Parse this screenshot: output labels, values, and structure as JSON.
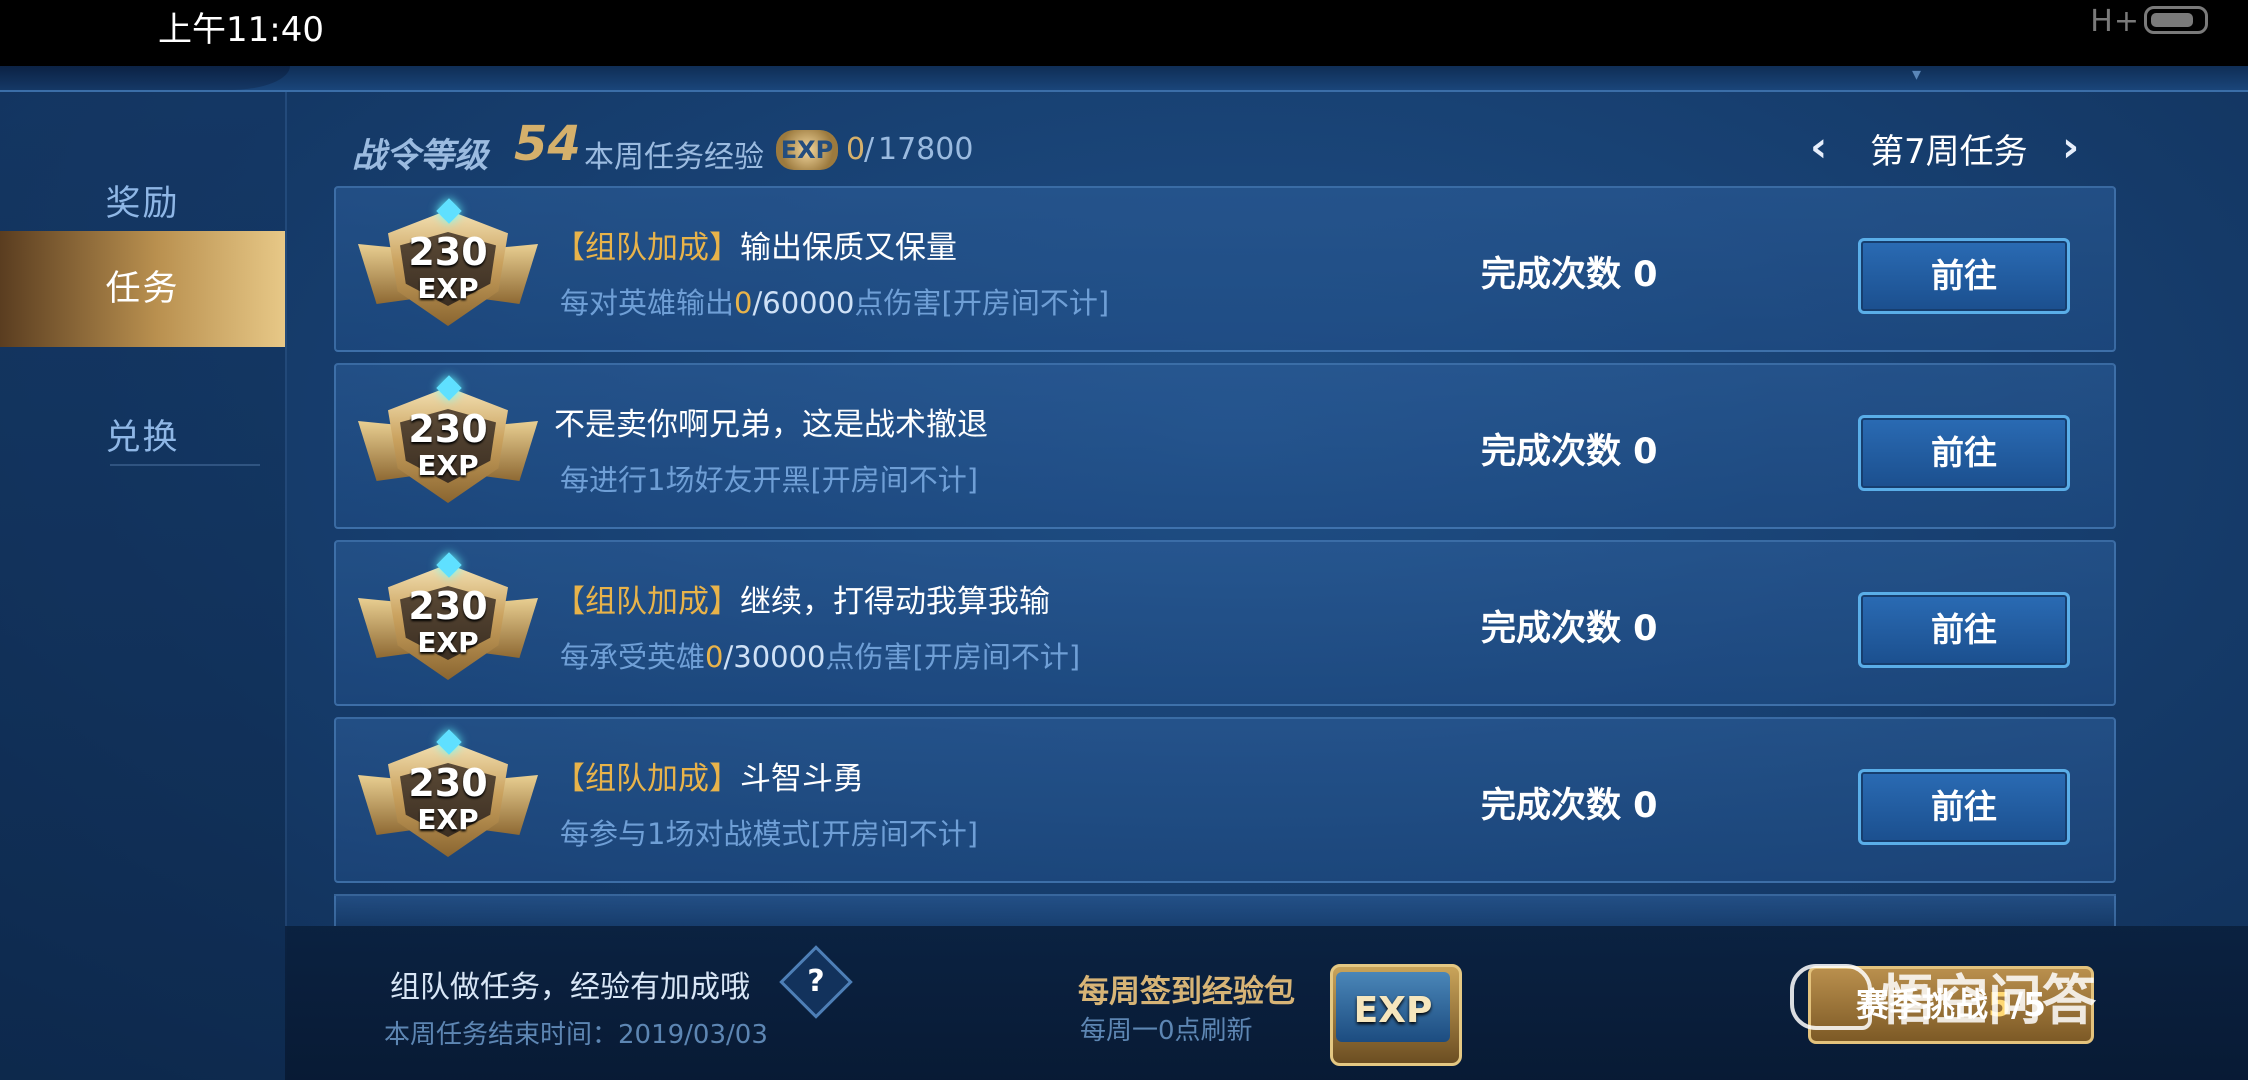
{
  "status_bar": {
    "time": "上午11:40",
    "network": "H+"
  },
  "sidebar": {
    "items": [
      {
        "label": "奖励",
        "active": false
      },
      {
        "label": "任务",
        "active": true
      },
      {
        "label": "兑换",
        "active": false
      }
    ]
  },
  "header": {
    "level_label": "战令等级",
    "level_value": "54",
    "exp_label": "本周任务经验",
    "exp_icon_text": "EXP",
    "exp_current": "0",
    "exp_sep": "/",
    "exp_max": "17800",
    "week_label": "第7周任务",
    "prev_icon": "chevron-left-icon",
    "next_icon": "chevron-right-icon"
  },
  "tasks": [
    {
      "reward": "230",
      "reward_unit": "EXP",
      "tag": "【组队加成】",
      "title": "输出保质又保量",
      "desc_pre": "每对英雄输出",
      "desc_progress": "0",
      "desc_total": "/60000",
      "desc_post": "点伤害[开房间不计]",
      "count_label": "完成次数 0",
      "button": "前往"
    },
    {
      "reward": "230",
      "reward_unit": "EXP",
      "tag": "",
      "title": "不是卖你啊兄弟，这是战术撤退",
      "desc_pre": "每进行1场好友开黑[开房间不计]",
      "desc_progress": "",
      "desc_total": "",
      "desc_post": "",
      "count_label": "完成次数 0",
      "button": "前往"
    },
    {
      "reward": "230",
      "reward_unit": "EXP",
      "tag": "【组队加成】",
      "title": "继续，打得动我算我输",
      "desc_pre": "每承受英雄",
      "desc_progress": "0",
      "desc_total": "/30000",
      "desc_post": "点伤害[开房间不计]",
      "count_label": "完成次数 0",
      "button": "前往"
    },
    {
      "reward": "230",
      "reward_unit": "EXP",
      "tag": "【组队加成】",
      "title": "斗智斗勇",
      "desc_pre": "每参与1场对战模式[开房间不计]",
      "desc_progress": "",
      "desc_total": "",
      "desc_post": "",
      "count_label": "完成次数 0",
      "button": "前往"
    }
  ],
  "footer": {
    "tip": "组队做任务，经验有加成哦",
    "help_icon": "?",
    "end_time": "本周任务结束时间：2019/03/03",
    "weekly_title": "每周签到经验包",
    "weekly_sub": "每周一0点刷新",
    "chest_label": "EXP",
    "season_prefix": "赛季挑战",
    "season_progress": "5",
    "season_suffix": "/5",
    "watermark": "悟空问答"
  }
}
